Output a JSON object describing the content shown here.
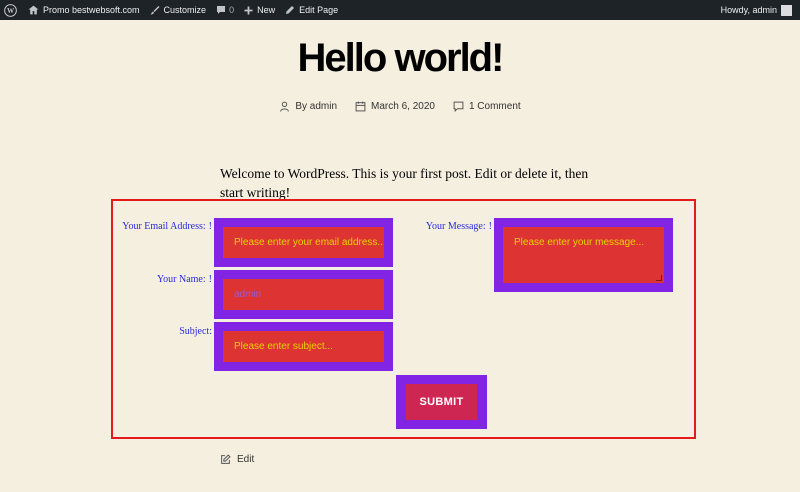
{
  "adminbar": {
    "site_name": "Promo bestwebsoft.com",
    "customize": "Customize",
    "comments_count": "0",
    "new": "New",
    "edit_page": "Edit Page",
    "greeting": "Howdy, admin"
  },
  "post": {
    "title": "Hello world!",
    "author": "By admin",
    "date": "March 6, 2020",
    "comments": "1 Comment",
    "intro": "Welcome to WordPress. This is your first post. Edit or delete it, then start writing!",
    "edit": "Edit"
  },
  "form": {
    "email_label": "Your Email Address:",
    "email_placeholder": "Please enter your email address...",
    "name_label": "Your Name:",
    "name_value": "admin",
    "subject_label": "Subject:",
    "subject_placeholder": "Please enter subject...",
    "message_label": "Your Message:",
    "message_placeholder": "Please enter your message...",
    "required_mark": "!",
    "submit_label": "SUBMIT"
  },
  "colors": {
    "form_border": "#e51b1b",
    "field_frame": "#8224e3",
    "field_bg": "#dd3333",
    "placeholder_text": "#e5d300",
    "label_text": "#2a2adf",
    "submit_bg": "#cd2653"
  }
}
